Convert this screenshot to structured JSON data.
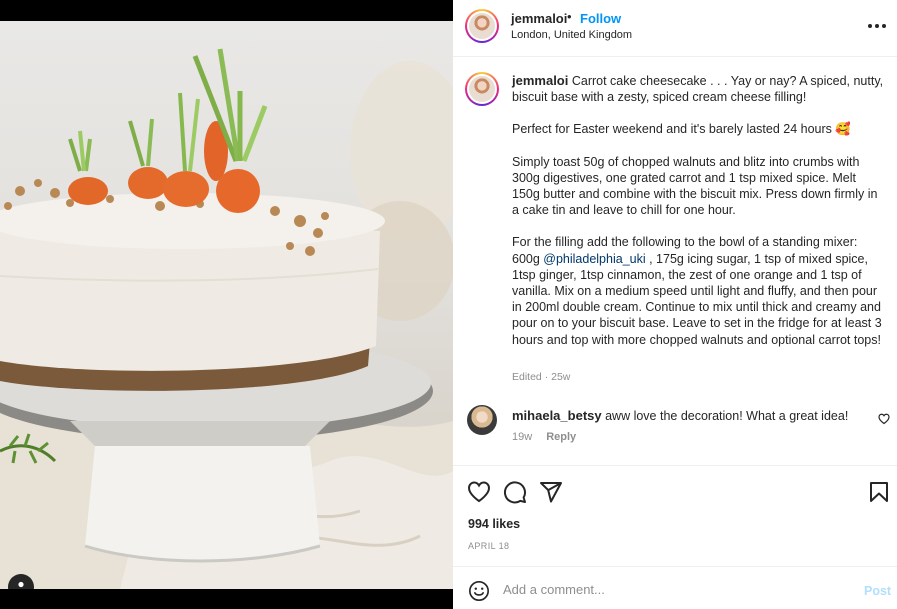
{
  "post": {
    "image_alt": "Carrot cake cheesecake",
    "author": {
      "username": "jemmaloi",
      "separator": "•",
      "follow_label": "Follow",
      "location": "London, United Kingdom"
    },
    "caption": {
      "username": "jemmaloi",
      "paragraphs": [
        "Carrot cake cheesecake . . . Yay or nay? A spiced, nutty, biscuit base with a zesty, spiced cream cheese filling!",
        "Perfect for Easter weekend and it's barely lasted 24 hours 🥰",
        "Simply toast 50g of chopped walnuts and blitz into crumbs with 300g digestives, one grated carrot and 1 tsp mixed spice. Melt 150g butter and combine with the biscuit mix. Press down firmly in a cake tin and leave to chill for one hour."
      ],
      "filling": {
        "before_mention": "For the filling add the following to the bowl of a standing mixer: 600g ",
        "mention": "@philadelphia_uki",
        "after_mention": " , 175g icing sugar, 1 tsp of mixed spice, 1tsp ginger, 1tsp cinnamon, the zest of one orange and 1 tsp of vanilla. Mix on a medium speed until light and fluffy, and then pour in 200ml double cream. Continue to mix until thick and creamy and pour on to your biscuit base. Leave to set in the fridge for at least 3 hours and top with more chopped walnuts and optional carrot tops!"
      },
      "meta": "Edited · 25w"
    },
    "comments": [
      {
        "username": "mihaela_betsy",
        "text": "aww love the decoration! What a great idea!",
        "age": "19w",
        "reply_label": "Reply"
      }
    ],
    "likes": "994 likes",
    "date": "APRIL 18",
    "add_comment": {
      "placeholder": "Add a comment...",
      "post_label": "Post"
    },
    "icons": {
      "more": "more-options-icon",
      "like": "heart-icon",
      "comment": "comment-icon",
      "share": "share-icon",
      "save": "bookmark-icon",
      "tag": "user-tag-icon",
      "emoji": "emoji-icon",
      "comment_like": "small-heart-icon"
    },
    "colors": {
      "follow": "#0095f6",
      "post_disabled": "#b2dffc",
      "muted": "#8e8e8e"
    }
  }
}
